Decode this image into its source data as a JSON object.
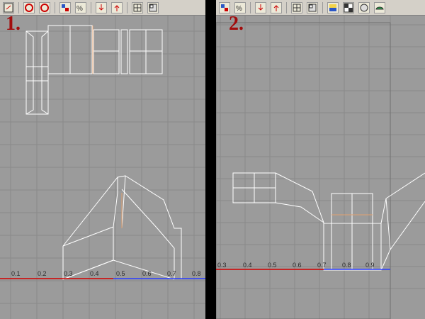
{
  "panels": [
    {
      "label": "1.",
      "ticks": [
        "0.1",
        "0.2",
        "0.3",
        "0.4",
        "0.5",
        "0.6",
        "0.7",
        "0.8"
      ]
    },
    {
      "label": "2.",
      "ticks": [
        "0.3",
        "0.4",
        "0.5",
        "0.6",
        "0.7",
        "0.8",
        "0.9"
      ]
    }
  ],
  "toolbar_icons_p1": [
    "select-icon",
    "undo-icon",
    "redo-icon",
    "transform-icon",
    "percent-snap-icon",
    "move-down-icon",
    "move-up-icon",
    "grid-icon",
    "window-icon"
  ],
  "toolbar_icons_p2": [
    "transform-icon",
    "percent-snap-icon",
    "move-down-icon",
    "move-up-icon",
    "grid-icon",
    "window-icon",
    "palette-icon",
    "checker-icon",
    "sphere-icon",
    "teapot-icon"
  ],
  "colors": {
    "viewport": "#9b9b9b",
    "grid": "#8a8a8a",
    "wire": "#ffffff",
    "seam": "#e0a070",
    "axis_red": "#d30000",
    "axis_blue": "#2b3cff"
  }
}
